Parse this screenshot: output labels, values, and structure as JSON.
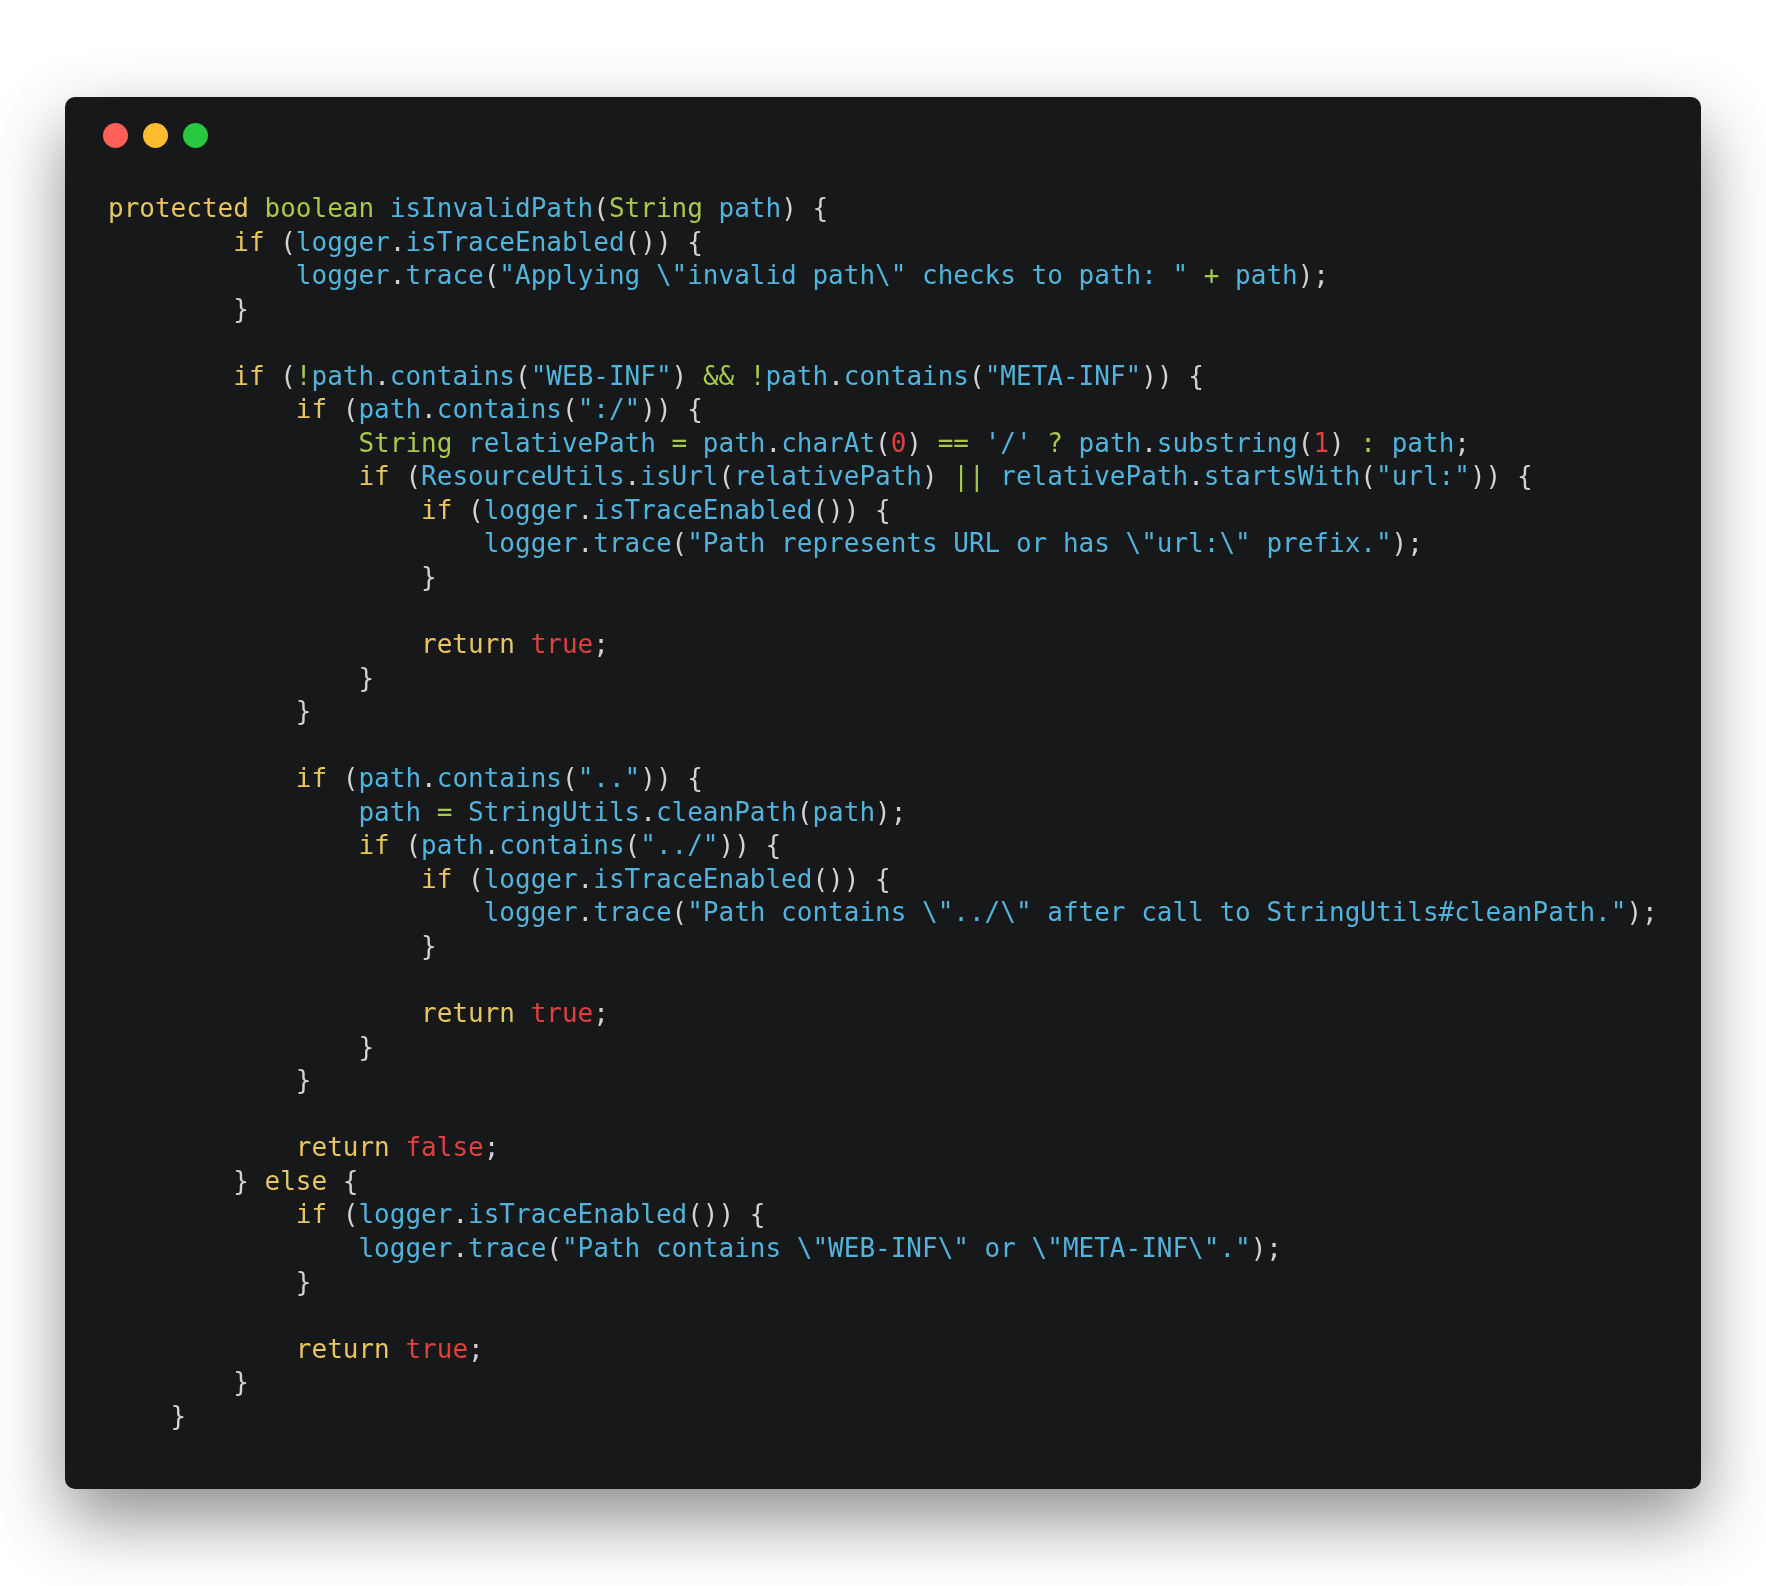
{
  "code_window": {
    "lines": [
      {
        "kind": "code",
        "tokens": [
          {
            "kind": "keyword",
            "text": "protected"
          },
          {
            "kind": "type",
            "text": " boolean"
          },
          {
            "kind": "name",
            "text": " isInvalidPath"
          },
          {
            "kind": "punct",
            "text": "("
          },
          {
            "kind": "type",
            "text": "String"
          },
          {
            "kind": "name",
            "text": " path"
          },
          {
            "kind": "punct",
            "text": ") {"
          }
        ]
      },
      {
        "kind": "code",
        "tokens": [
          {
            "kind": "keyword",
            "text": "        if"
          },
          {
            "kind": "punct",
            "text": " ("
          },
          {
            "kind": "name",
            "text": "logger"
          },
          {
            "kind": "punct",
            "text": "."
          },
          {
            "kind": "name",
            "text": "isTraceEnabled"
          },
          {
            "kind": "punct",
            "text": "()) {"
          }
        ]
      },
      {
        "kind": "code",
        "tokens": [
          {
            "kind": "name",
            "text": "            logger"
          },
          {
            "kind": "punct",
            "text": "."
          },
          {
            "kind": "name",
            "text": "trace"
          },
          {
            "kind": "punct",
            "text": "("
          },
          {
            "kind": "string",
            "text": "\"Applying \\\"invalid path\\\" checks to path: \""
          },
          {
            "kind": "operator",
            "text": " +"
          },
          {
            "kind": "name",
            "text": " path"
          },
          {
            "kind": "punct",
            "text": ");"
          }
        ]
      },
      {
        "kind": "code",
        "tokens": [
          {
            "kind": "punct",
            "text": "        }"
          }
        ]
      },
      {
        "kind": "blank"
      },
      {
        "kind": "code",
        "tokens": [
          {
            "kind": "keyword",
            "text": "        if"
          },
          {
            "kind": "punct",
            "text": " ("
          },
          {
            "kind": "operator",
            "text": "!"
          },
          {
            "kind": "name",
            "text": "path"
          },
          {
            "kind": "punct",
            "text": "."
          },
          {
            "kind": "name",
            "text": "contains"
          },
          {
            "kind": "punct",
            "text": "("
          },
          {
            "kind": "string",
            "text": "\"WEB-INF\""
          },
          {
            "kind": "punct",
            "text": ")"
          },
          {
            "kind": "operator",
            "text": " && !"
          },
          {
            "kind": "name",
            "text": "path"
          },
          {
            "kind": "punct",
            "text": "."
          },
          {
            "kind": "name",
            "text": "contains"
          },
          {
            "kind": "punct",
            "text": "("
          },
          {
            "kind": "string",
            "text": "\"META-INF\""
          },
          {
            "kind": "punct",
            "text": ")) {"
          }
        ]
      },
      {
        "kind": "code",
        "tokens": [
          {
            "kind": "keyword",
            "text": "            if"
          },
          {
            "kind": "punct",
            "text": " ("
          },
          {
            "kind": "name",
            "text": "path"
          },
          {
            "kind": "punct",
            "text": "."
          },
          {
            "kind": "name",
            "text": "contains"
          },
          {
            "kind": "punct",
            "text": "("
          },
          {
            "kind": "string",
            "text": "\":/\""
          },
          {
            "kind": "punct",
            "text": ")) {"
          }
        ]
      },
      {
        "kind": "code",
        "tokens": [
          {
            "kind": "type",
            "text": "                String"
          },
          {
            "kind": "name",
            "text": " relativePath"
          },
          {
            "kind": "operator",
            "text": " ="
          },
          {
            "kind": "name",
            "text": " path"
          },
          {
            "kind": "punct",
            "text": "."
          },
          {
            "kind": "name",
            "text": "charAt"
          },
          {
            "kind": "punct",
            "text": "("
          },
          {
            "kind": "literal",
            "text": "0"
          },
          {
            "kind": "punct",
            "text": ")"
          },
          {
            "kind": "operator",
            "text": " =="
          },
          {
            "kind": "string",
            "text": " '/'"
          },
          {
            "kind": "operator",
            "text": " ?"
          },
          {
            "kind": "name",
            "text": " path"
          },
          {
            "kind": "punct",
            "text": "."
          },
          {
            "kind": "name",
            "text": "substring"
          },
          {
            "kind": "punct",
            "text": "("
          },
          {
            "kind": "literal",
            "text": "1"
          },
          {
            "kind": "punct",
            "text": ")"
          },
          {
            "kind": "operator",
            "text": " :"
          },
          {
            "kind": "name",
            "text": " path"
          },
          {
            "kind": "punct",
            "text": ";"
          }
        ]
      },
      {
        "kind": "code",
        "tokens": [
          {
            "kind": "keyword",
            "text": "                if"
          },
          {
            "kind": "punct",
            "text": " ("
          },
          {
            "kind": "name",
            "text": "ResourceUtils"
          },
          {
            "kind": "punct",
            "text": "."
          },
          {
            "kind": "name",
            "text": "isUrl"
          },
          {
            "kind": "punct",
            "text": "("
          },
          {
            "kind": "name",
            "text": "relativePath"
          },
          {
            "kind": "punct",
            "text": ")"
          },
          {
            "kind": "operator",
            "text": " ||"
          },
          {
            "kind": "name",
            "text": " relativePath"
          },
          {
            "kind": "punct",
            "text": "."
          },
          {
            "kind": "name",
            "text": "startsWith"
          },
          {
            "kind": "punct",
            "text": "("
          },
          {
            "kind": "string",
            "text": "\"url:\""
          },
          {
            "kind": "punct",
            "text": ")) {"
          }
        ]
      },
      {
        "kind": "code",
        "tokens": [
          {
            "kind": "keyword",
            "text": "                    if"
          },
          {
            "kind": "punct",
            "text": " ("
          },
          {
            "kind": "name",
            "text": "logger"
          },
          {
            "kind": "punct",
            "text": "."
          },
          {
            "kind": "name",
            "text": "isTraceEnabled"
          },
          {
            "kind": "punct",
            "text": "()) {"
          }
        ]
      },
      {
        "kind": "code",
        "tokens": [
          {
            "kind": "name",
            "text": "                        logger"
          },
          {
            "kind": "punct",
            "text": "."
          },
          {
            "kind": "name",
            "text": "trace"
          },
          {
            "kind": "punct",
            "text": "("
          },
          {
            "kind": "string",
            "text": "\"Path represents URL or has \\\"url:\\\" prefix.\""
          },
          {
            "kind": "punct",
            "text": ");"
          }
        ]
      },
      {
        "kind": "code",
        "tokens": [
          {
            "kind": "punct",
            "text": "                    }"
          }
        ]
      },
      {
        "kind": "blank"
      },
      {
        "kind": "code",
        "tokens": [
          {
            "kind": "keyword",
            "text": "                    return"
          },
          {
            "kind": "literal",
            "text": " true"
          },
          {
            "kind": "punct",
            "text": ";"
          }
        ]
      },
      {
        "kind": "code",
        "tokens": [
          {
            "kind": "punct",
            "text": "                }"
          }
        ]
      },
      {
        "kind": "code",
        "tokens": [
          {
            "kind": "punct",
            "text": "            }"
          }
        ]
      },
      {
        "kind": "blank"
      },
      {
        "kind": "code",
        "tokens": [
          {
            "kind": "keyword",
            "text": "            if"
          },
          {
            "kind": "punct",
            "text": " ("
          },
          {
            "kind": "name",
            "text": "path"
          },
          {
            "kind": "punct",
            "text": "."
          },
          {
            "kind": "name",
            "text": "contains"
          },
          {
            "kind": "punct",
            "text": "("
          },
          {
            "kind": "string",
            "text": "\"..\""
          },
          {
            "kind": "punct",
            "text": ")) {"
          }
        ]
      },
      {
        "kind": "code",
        "tokens": [
          {
            "kind": "name",
            "text": "                path"
          },
          {
            "kind": "operator",
            "text": " ="
          },
          {
            "kind": "name",
            "text": " StringUtils"
          },
          {
            "kind": "punct",
            "text": "."
          },
          {
            "kind": "name",
            "text": "cleanPath"
          },
          {
            "kind": "punct",
            "text": "("
          },
          {
            "kind": "name",
            "text": "path"
          },
          {
            "kind": "punct",
            "text": ");"
          }
        ]
      },
      {
        "kind": "code",
        "tokens": [
          {
            "kind": "keyword",
            "text": "                if"
          },
          {
            "kind": "punct",
            "text": " ("
          },
          {
            "kind": "name",
            "text": "path"
          },
          {
            "kind": "punct",
            "text": "."
          },
          {
            "kind": "name",
            "text": "contains"
          },
          {
            "kind": "punct",
            "text": "("
          },
          {
            "kind": "string",
            "text": "\"../\""
          },
          {
            "kind": "punct",
            "text": ")) {"
          }
        ]
      },
      {
        "kind": "code",
        "tokens": [
          {
            "kind": "keyword",
            "text": "                    if"
          },
          {
            "kind": "punct",
            "text": " ("
          },
          {
            "kind": "name",
            "text": "logger"
          },
          {
            "kind": "punct",
            "text": "."
          },
          {
            "kind": "name",
            "text": "isTraceEnabled"
          },
          {
            "kind": "punct",
            "text": "()) {"
          }
        ]
      },
      {
        "kind": "code",
        "tokens": [
          {
            "kind": "name",
            "text": "                        logger"
          },
          {
            "kind": "punct",
            "text": "."
          },
          {
            "kind": "name",
            "text": "trace"
          },
          {
            "kind": "punct",
            "text": "("
          },
          {
            "kind": "string",
            "text": "\"Path contains \\\"../\\\" after call to StringUtils#cleanPath.\""
          },
          {
            "kind": "punct",
            "text": ");"
          }
        ]
      },
      {
        "kind": "code",
        "tokens": [
          {
            "kind": "punct",
            "text": "                    }"
          }
        ]
      },
      {
        "kind": "blank"
      },
      {
        "kind": "code",
        "tokens": [
          {
            "kind": "keyword",
            "text": "                    return"
          },
          {
            "kind": "literal",
            "text": " true"
          },
          {
            "kind": "punct",
            "text": ";"
          }
        ]
      },
      {
        "kind": "code",
        "tokens": [
          {
            "kind": "punct",
            "text": "                }"
          }
        ]
      },
      {
        "kind": "code",
        "tokens": [
          {
            "kind": "punct",
            "text": "            }"
          }
        ]
      },
      {
        "kind": "blank"
      },
      {
        "kind": "code",
        "tokens": [
          {
            "kind": "keyword",
            "text": "            return"
          },
          {
            "kind": "literal",
            "text": " false"
          },
          {
            "kind": "punct",
            "text": ";"
          }
        ]
      },
      {
        "kind": "code",
        "tokens": [
          {
            "kind": "punct",
            "text": "        }"
          },
          {
            "kind": "keyword",
            "text": " else"
          },
          {
            "kind": "punct",
            "text": " {"
          }
        ]
      },
      {
        "kind": "code",
        "tokens": [
          {
            "kind": "keyword",
            "text": "            if"
          },
          {
            "kind": "punct",
            "text": " ("
          },
          {
            "kind": "name",
            "text": "logger"
          },
          {
            "kind": "punct",
            "text": "."
          },
          {
            "kind": "name",
            "text": "isTraceEnabled"
          },
          {
            "kind": "punct",
            "text": "()) {"
          }
        ]
      },
      {
        "kind": "code",
        "tokens": [
          {
            "kind": "name",
            "text": "                logger"
          },
          {
            "kind": "punct",
            "text": "."
          },
          {
            "kind": "name",
            "text": "trace"
          },
          {
            "kind": "punct",
            "text": "("
          },
          {
            "kind": "string",
            "text": "\"Path contains \\\"WEB-INF\\\" or \\\"META-INF\\\".\""
          },
          {
            "kind": "punct",
            "text": ");"
          }
        ]
      },
      {
        "kind": "code",
        "tokens": [
          {
            "kind": "punct",
            "text": "            }"
          }
        ]
      },
      {
        "kind": "blank"
      },
      {
        "kind": "code",
        "tokens": [
          {
            "kind": "keyword",
            "text": "            return"
          },
          {
            "kind": "literal",
            "text": " true"
          },
          {
            "kind": "punct",
            "text": ";"
          }
        ]
      },
      {
        "kind": "code",
        "tokens": [
          {
            "kind": "punct",
            "text": "        }"
          }
        ]
      },
      {
        "kind": "code",
        "tokens": [
          {
            "kind": "punct",
            "text": "    }"
          }
        ]
      }
    ]
  }
}
